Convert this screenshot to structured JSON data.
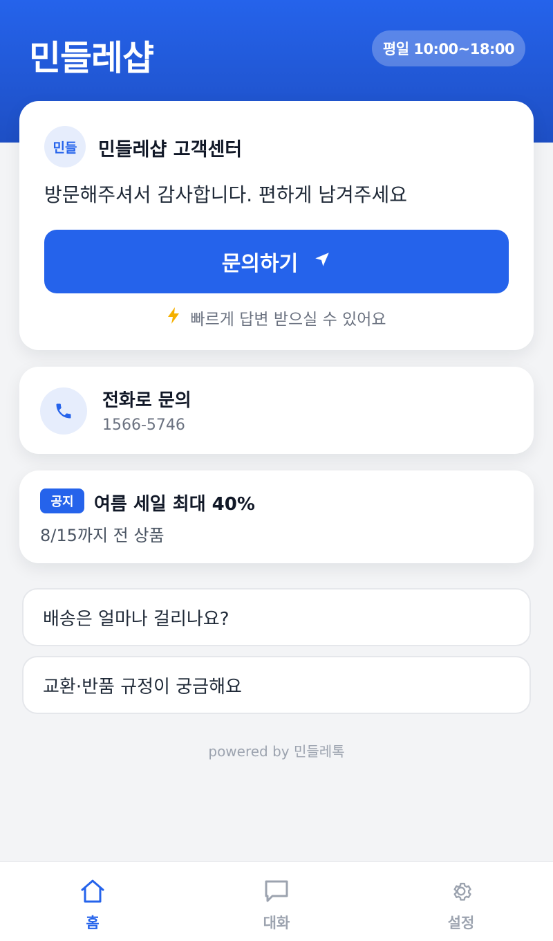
{
  "header": {
    "brand": "민들레샵",
    "hours": "평일 10:00~18:00"
  },
  "welcome_card": {
    "logo_text": "민들",
    "title": "민들레샵 고객센터",
    "message": "방문해주셔서 감사합니다. 편하게 남겨주세요",
    "inquiry_button": "문의하기",
    "inquiry_icon": "send-arrow-icon",
    "fast_note_icon": "lightning-icon",
    "fast_note": "빠르게 답변 받으실 수 있어요"
  },
  "phone_card": {
    "icon": "phone-icon",
    "title": "전화로 문의",
    "number": "1566-5746"
  },
  "notice_card": {
    "badge": "공지",
    "title": "여름 세일 최대 40%",
    "subtitle": "8/15까지 전 상품"
  },
  "faq": [
    {
      "text": "배송은 얼마나 걸리나요?"
    },
    {
      "text": "교환·반품 규정이 궁금해요"
    }
  ],
  "powered_by": "powered by 민들레톡",
  "tabbar": [
    {
      "label": "홈",
      "icon": "home-icon",
      "active": true
    },
    {
      "label": "대화",
      "icon": "chat-icon",
      "active": false
    },
    {
      "label": "설정",
      "icon": "gear-icon",
      "active": false
    }
  ],
  "colors": {
    "primary": "#2563eb",
    "background": "#f3f4f6",
    "muted": "#9ca3af",
    "accent_lightning": "#f5b000"
  }
}
